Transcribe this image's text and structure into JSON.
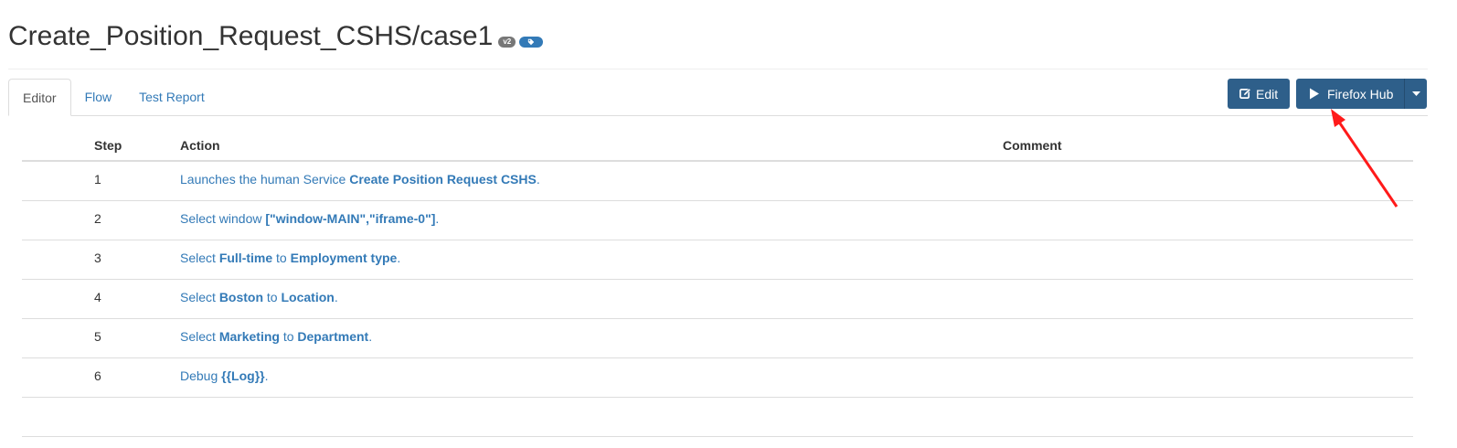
{
  "header": {
    "title": "Create_Position_Request_CSHS/case1",
    "version_badge": "v2",
    "tag_icon": "tag-icon"
  },
  "tabs": [
    {
      "label": "Editor",
      "active": true
    },
    {
      "label": "Flow",
      "active": false
    },
    {
      "label": "Test Report",
      "active": false
    }
  ],
  "toolbar": {
    "edit_label": "Edit",
    "edit_icon": "edit-icon",
    "run_label": "Firefox Hub",
    "run_icon": "play-icon",
    "caret_icon": "caret-down-icon"
  },
  "table": {
    "headers": {
      "step": "Step",
      "action": "Action",
      "comment": "Comment"
    },
    "rows": [
      {
        "step": "1",
        "parts": [
          [
            "Launches the human Service ",
            false
          ],
          [
            "Create Position Request CSHS",
            true
          ],
          [
            ".",
            false
          ]
        ]
      },
      {
        "step": "2",
        "parts": [
          [
            "Select window ",
            false
          ],
          [
            "[\"window-MAIN\",\"iframe-0\"]",
            true
          ],
          [
            ".",
            false
          ]
        ]
      },
      {
        "step": "3",
        "parts": [
          [
            "Select ",
            false
          ],
          [
            "Full-time",
            true
          ],
          [
            " to ",
            false
          ],
          [
            "Employment type",
            true
          ],
          [
            ".",
            false
          ]
        ]
      },
      {
        "step": "4",
        "parts": [
          [
            "Select ",
            false
          ],
          [
            "Boston",
            true
          ],
          [
            " to ",
            false
          ],
          [
            "Location",
            true
          ],
          [
            ".",
            false
          ]
        ]
      },
      {
        "step": "5",
        "parts": [
          [
            "Select ",
            false
          ],
          [
            "Marketing",
            true
          ],
          [
            " to ",
            false
          ],
          [
            "Department",
            true
          ],
          [
            ".",
            false
          ]
        ]
      },
      {
        "step": "6",
        "parts": [
          [
            "Debug ",
            false
          ],
          [
            "{{Log}}",
            true
          ],
          [
            ".",
            false
          ]
        ]
      }
    ]
  },
  "colors": {
    "link": "#337ab7",
    "button": "#2e5f8a",
    "annotation_arrow": "#ff1a1a"
  }
}
